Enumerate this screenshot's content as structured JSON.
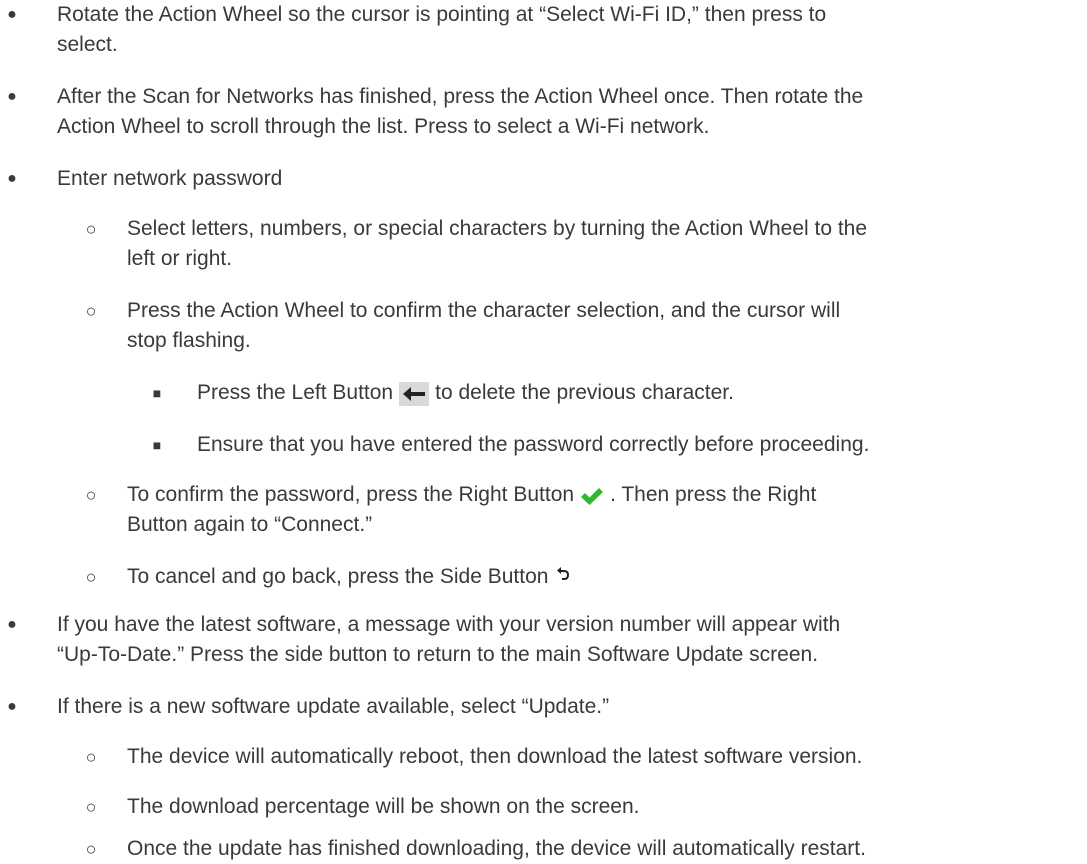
{
  "bullets": {
    "level1": "●",
    "level2": "○",
    "level3": "■"
  },
  "items": {
    "i1": {
      "line1": "Rotate the Action Wheel so the cursor is pointing at “Select Wi-Fi ID,” then press to",
      "line2": "select."
    },
    "i2": {
      "line1": "After the Scan for Networks has finished, press the Action Wheel once. Then rotate the",
      "line2": "Action Wheel to scroll through the list. Press to select a Wi-Fi network."
    },
    "i3": {
      "line1": "Enter network password"
    },
    "i3a": {
      "line1": "Select letters, numbers, or special characters by turning the Action Wheel to the",
      "line2": "left or right."
    },
    "i3b": {
      "line1": "Press the Action Wheel to confirm the character selection, and the cursor will",
      "line2": "stop flashing."
    },
    "i3b1": {
      "before": "Press the Left Button",
      "after": "to delete the previous character."
    },
    "i3b2": {
      "line1": "Ensure that you have entered the password correctly before proceeding."
    },
    "i3c": {
      "before": "To confirm the password, press the Right Button",
      "after": ". Then press the Right",
      "line2": "Button again to “Connect.”"
    },
    "i3d": {
      "before": "To cancel and go back, press the Side Button"
    },
    "i4": {
      "line1": "If you have the latest software, a message with your version number will appear with",
      "line2": "“Up-To-Date.” Press the side button to return to the main Software Update screen."
    },
    "i5": {
      "line1": "If there is a new software update available, select “Update.”"
    },
    "i5a": {
      "line1": "The device will automatically reboot, then download the latest software version."
    },
    "i5b": {
      "line1": "The download percentage will be shown on the screen."
    },
    "i5c": {
      "line1": "Once the update has finished downloading, the device will automatically restart."
    }
  },
  "icons": {
    "left": "left-arrow-icon",
    "check": "checkmark-icon",
    "back": "back-arrow-icon"
  },
  "colors": {
    "text": "#3a3a3a",
    "check_green": "#2db82d",
    "icon_box_bg": "#d9d9d9"
  }
}
